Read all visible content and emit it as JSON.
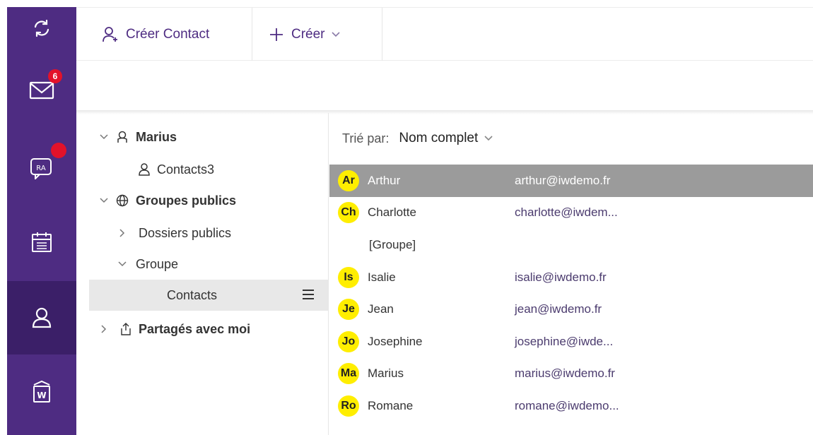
{
  "colors": {
    "rail": "#4e2c82",
    "rail_active": "#3b1f68",
    "accent": "#4e2c82",
    "badge": "#e3122a",
    "avatar": "#ffee00",
    "selected_row": "#9b9b9b"
  },
  "rail": {
    "items": [
      {
        "icon": "sync-icon"
      },
      {
        "icon": "mail-icon",
        "badge": "6"
      },
      {
        "icon": "chat-icon",
        "badge_dot": true
      },
      {
        "icon": "calendar-icon"
      },
      {
        "icon": "contacts-icon",
        "active": true
      },
      {
        "icon": "word-doc-icon"
      }
    ]
  },
  "toolbar": {
    "create_contact_label": "Créer Contact",
    "create_label": "Créer"
  },
  "tree": {
    "marius": "Marius",
    "contacts3": "Contacts3",
    "groupes_publics": "Groupes publics",
    "dossiers_publics": "Dossiers publics",
    "groupe": "Groupe",
    "contacts": "Contacts",
    "partages": "Partagés avec moi"
  },
  "sort": {
    "label": "Trié par:",
    "value": "Nom complet"
  },
  "contacts": [
    {
      "initials": "Ar",
      "name": "Arthur",
      "email": "arthur@iwdemo.fr",
      "selected": true
    },
    {
      "initials": "Ch",
      "name": "Charlotte",
      "email": "charlotte@iwdem..."
    },
    {
      "initials": "",
      "name": "[Groupe]",
      "email": ""
    },
    {
      "initials": "Is",
      "name": "Isalie",
      "email": "isalie@iwdemo.fr"
    },
    {
      "initials": "Je",
      "name": "Jean",
      "email": "jean@iwdemo.fr"
    },
    {
      "initials": "Jo",
      "name": "Josephine",
      "email": "josephine@iwde..."
    },
    {
      "initials": "Ma",
      "name": "Marius",
      "email": "marius@iwdemo.fr"
    },
    {
      "initials": "Ro",
      "name": "Romane",
      "email": "romane@iwdemo..."
    }
  ]
}
